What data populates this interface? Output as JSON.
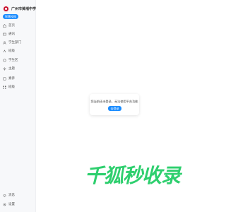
{
  "sidebar": {
    "school_name": "广州市黄埔中学",
    "tag": "智慧校园",
    "items": [
      {
        "label": "首页",
        "icon": "home-icon"
      },
      {
        "label": "通讯",
        "icon": "message-icon"
      },
      {
        "label": "学生部门",
        "icon": "users-icon"
      },
      {
        "label": "班级",
        "icon": "class-icon"
      },
      {
        "label": "学生区",
        "icon": "student-icon"
      },
      {
        "label": "主题",
        "icon": "theme-icon"
      },
      {
        "label": "素养",
        "icon": "star-icon"
      },
      {
        "label": "班级",
        "icon": "grid-icon"
      }
    ],
    "bottom_items": [
      {
        "label": "消息",
        "icon": "bell-icon"
      },
      {
        "label": "设置",
        "icon": "gear-icon"
      }
    ]
  },
  "main": {
    "message": "您当前还未登录，无法使用平台功能",
    "login_button": "去登录"
  },
  "watermark": "千狐秒收录",
  "colors": {
    "accent": "#1a8cff",
    "brand_red": "#c8102e",
    "watermark_green": "#2ecf6e"
  }
}
